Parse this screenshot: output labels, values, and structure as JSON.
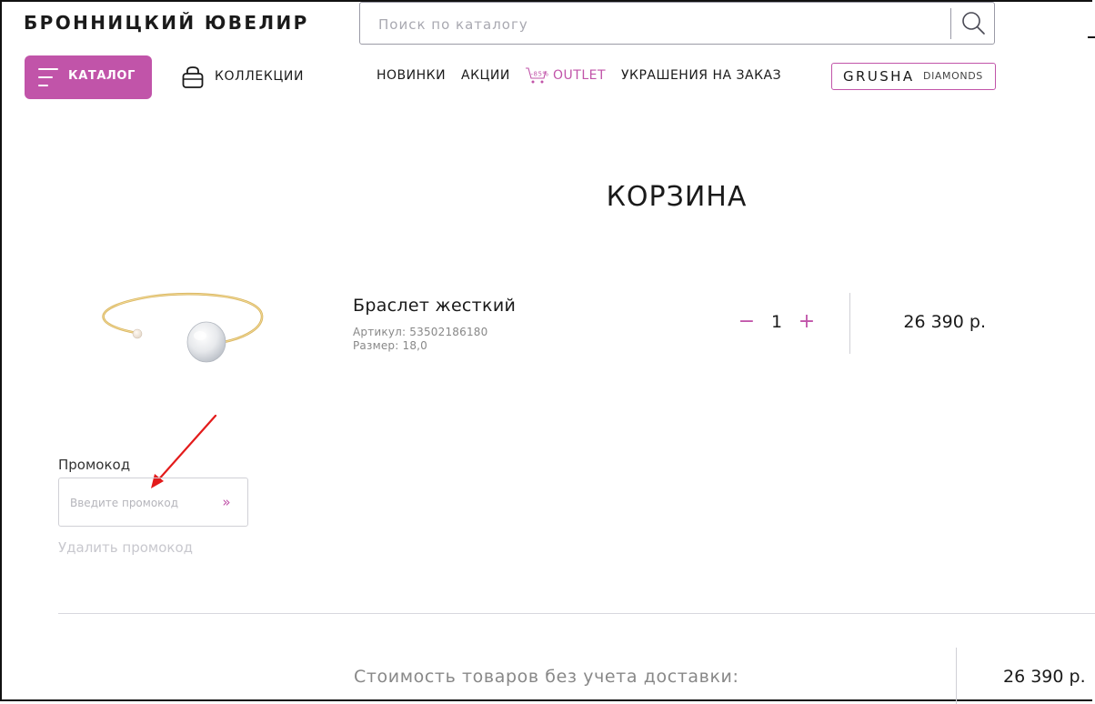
{
  "header": {
    "logo": "БРОННИЦКИЙ ЮВЕЛИР",
    "search_placeholder": "Поиск по каталогу",
    "catalog_button": "КАТАЛОГ",
    "collections": "КОЛЛЕКЦИИ",
    "nav": {
      "new": "НОВИНКИ",
      "sales": "АКЦИИ",
      "outlet_badge": "-85%",
      "outlet": "OUTLET",
      "custom": "УКРАШЕНИЯ НА ЗАКАЗ"
    },
    "grusha": {
      "part1": "GRUSHA",
      "part2": "DIAMONDS"
    }
  },
  "page": {
    "title": "КОРЗИНА"
  },
  "cart_item": {
    "name": "Браслет жесткий",
    "article": "Артикул: 53502186180",
    "size": "Размер: 18,0",
    "minus": "−",
    "quantity": "1",
    "plus": "+",
    "price": "26 390 р."
  },
  "promo": {
    "label": "Промокод",
    "placeholder": "Введите промокод",
    "submit_icon": "»",
    "remove": "Удалить промокод"
  },
  "summary": {
    "label": "Стоимость товаров без учета доставки:",
    "value": "26 390 р."
  },
  "colors": {
    "accent": "#c154a9",
    "annotation_arrow": "#e31b1b"
  },
  "icons": {
    "search": "search-icon",
    "menu": "burger-menu-icon",
    "collections": "bag-icon",
    "outlet": "cart-discount-icon",
    "promo_submit": "double-chevron-right-icon"
  }
}
